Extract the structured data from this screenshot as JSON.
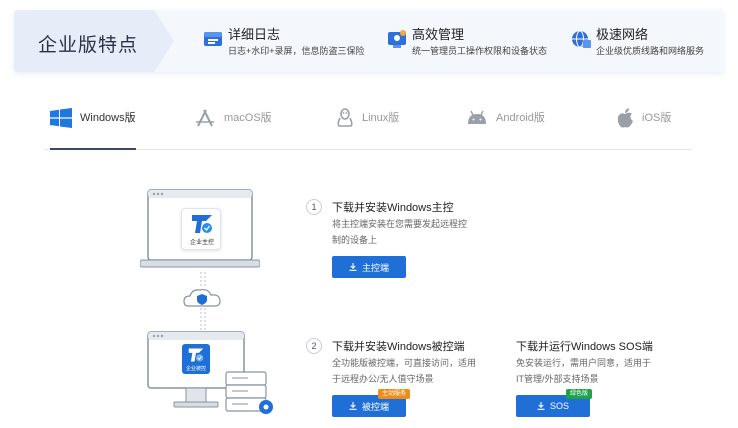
{
  "banner": {
    "title": "企业版特点",
    "features": [
      {
        "icon": "log-icon",
        "title": "详细日志",
        "desc": "日志+水印+录屏，信息防盗三保险"
      },
      {
        "icon": "management-icon",
        "title": "高效管理",
        "desc": "统一管理员工操作权限和设备状态"
      },
      {
        "icon": "network-icon",
        "title": "极速网络",
        "desc": "企业级优质线路和网络服务"
      }
    ]
  },
  "tabs": [
    {
      "label": "Windows版",
      "icon": "windows-icon",
      "active": true
    },
    {
      "label": "macOS版",
      "icon": "macos-icon",
      "active": false
    },
    {
      "label": "Linux版",
      "icon": "linux-icon",
      "active": false
    },
    {
      "label": "Android版",
      "icon": "android-icon",
      "active": false
    },
    {
      "label": "iOS版",
      "icon": "apple-icon",
      "active": false
    }
  ],
  "illustration": {
    "controller_label": "企业主控",
    "controlled_label": "企业被控"
  },
  "steps": {
    "step1": {
      "num": "1",
      "title": "下载并安装Windows主控",
      "desc": "将主控端安装在您需要发起远程控制的设备上",
      "button": "主控端"
    },
    "step2": {
      "num": "2",
      "title": "下载并安装Windows被控端",
      "desc": "全功能版被控端，可直接访问，适用于远程办公/无人值守场景",
      "button": "被控端",
      "badge": "主动服务"
    },
    "sos": {
      "title": "下载并运行Windows SOS端",
      "desc": "免安装运行，需用户同意，适用于IT管理/外部支持场景",
      "button": "SOS",
      "badge": "绿色版"
    }
  },
  "colors": {
    "accent": "#1f6fd6",
    "badge_orange": "#f08c1a",
    "badge_green": "#1fa34a"
  }
}
